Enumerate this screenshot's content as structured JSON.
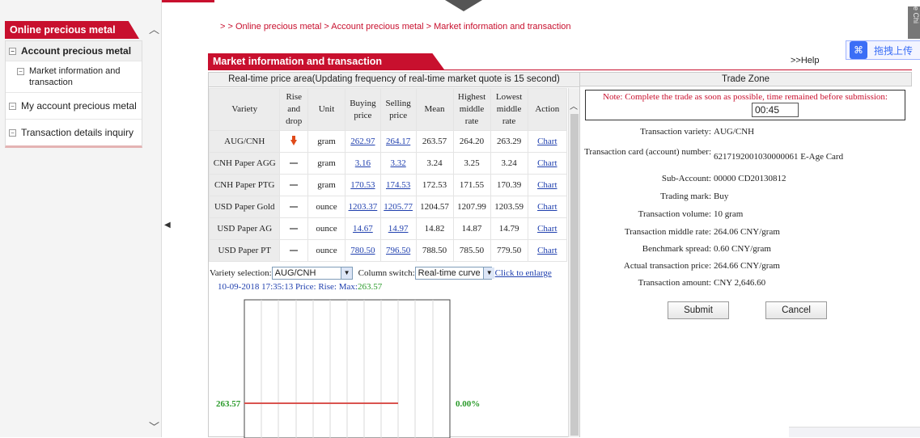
{
  "breadcrumb": "> > Online precious metal > Account precious metal > Market information and transaction",
  "sidebar": {
    "title": "Online precious metal",
    "items": [
      {
        "label": "Account precious metal",
        "active": true
      },
      {
        "label": "Market information and transaction",
        "sub": true
      },
      {
        "label": "My account precious metal"
      },
      {
        "label": "Transaction details inquiry"
      }
    ]
  },
  "panel": {
    "title": "Market information and transaction",
    "help": ">>Help"
  },
  "baidu": {
    "text": "拖拽上传"
  },
  "side_tab": "e Chi",
  "realtime": {
    "title": "Real-time price area(Updating frequency of real-time market quote is 15 second)",
    "headers": [
      "Variety",
      "Rise and drop",
      "Unit",
      "Buying price",
      "Selling price",
      "Mean",
      "Highest middle rate",
      "Lowest middle rate",
      "Action"
    ],
    "rows": [
      {
        "variety": "AUG/CNH",
        "trend": "down",
        "unit": "gram",
        "buy": "262.97",
        "sell": "264.17",
        "mean": "263.57",
        "high": "264.20",
        "low": "263.29",
        "action": "Chart"
      },
      {
        "variety": "CNH Paper AGG",
        "trend": "flat",
        "unit": "gram",
        "buy": "3.16",
        "sell": "3.32",
        "mean": "3.24",
        "high": "3.25",
        "low": "3.24",
        "action": "Chart"
      },
      {
        "variety": "CNH Paper PTG",
        "trend": "flat",
        "unit": "gram",
        "buy": "170.53",
        "sell": "174.53",
        "mean": "172.53",
        "high": "171.55",
        "low": "170.39",
        "action": "Chart"
      },
      {
        "variety": "USD Paper Gold",
        "trend": "flat",
        "unit": "ounce",
        "buy": "1203.37",
        "sell": "1205.77",
        "mean": "1204.57",
        "high": "1207.99",
        "low": "1203.59",
        "action": "Chart"
      },
      {
        "variety": "USD Paper AG",
        "trend": "flat",
        "unit": "ounce",
        "buy": "14.67",
        "sell": "14.97",
        "mean": "14.82",
        "high": "14.87",
        "low": "14.79",
        "action": "Chart"
      },
      {
        "variety": "USD Paper PT",
        "trend": "flat",
        "unit": "ounce",
        "buy": "780.50",
        "sell": "796.50",
        "mean": "788.50",
        "high": "785.50",
        "low": "779.50",
        "action": "Chart"
      }
    ],
    "variety_label": "Variety selection:",
    "variety_value": "AUG/CNH",
    "column_label": "Column switch:",
    "column_value": "Real-time curve",
    "enlarge": "Click to enlarge",
    "price_line_prefix": "10-09-2018 17:35:13 Price: Rise: Max:",
    "price_line_max": "263.57",
    "chart_left_label": "263.57",
    "chart_right_label": "0.00%"
  },
  "trade": {
    "title": "Trade Zone",
    "note": "Note: Complete the trade as soon as possible, time remained before submission:",
    "timer": "00:45",
    "fields": [
      {
        "label": "Transaction variety:",
        "value": "AUG/CNH"
      },
      {
        "label": "Transaction card (account) number:",
        "value": "6217192001030000061 E-Age Card"
      },
      {
        "label": "Sub-Account:",
        "value": "00000 CD20130812"
      },
      {
        "label": "Trading mark:",
        "value": "Buy"
      },
      {
        "label": "Transaction volume:",
        "value": "10 gram"
      },
      {
        "label": "Transaction middle rate:",
        "value": "264.06 CNY/gram"
      },
      {
        "label": "Benchmark spread:",
        "value": "0.60 CNY/gram"
      },
      {
        "label": "Actual transaction price:",
        "value": "264.66 CNY/gram"
      },
      {
        "label": "Transaction amount:",
        "value": "CNY 2,646.60"
      }
    ],
    "submit": "Submit",
    "cancel": "Cancel"
  }
}
